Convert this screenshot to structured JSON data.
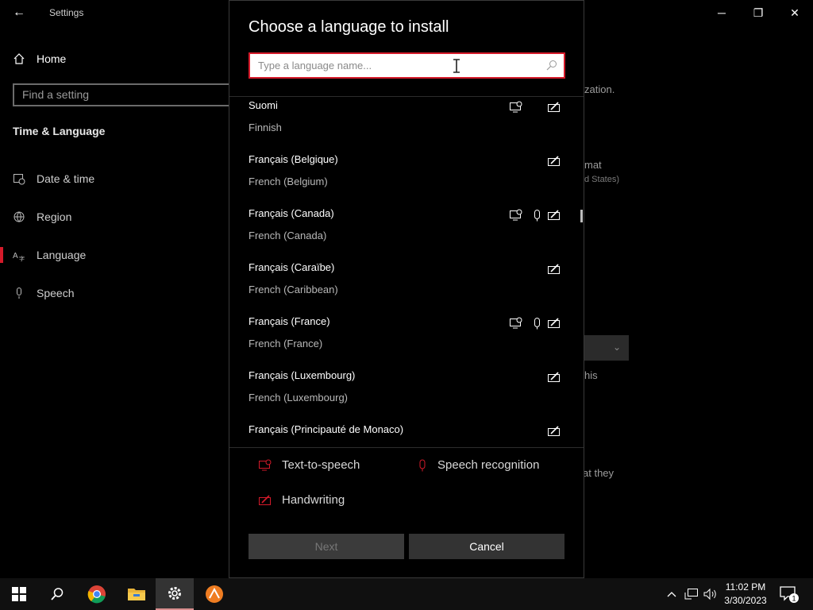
{
  "window": {
    "app_title": "Settings",
    "back_glyph": "←",
    "minimize_glyph": "─",
    "maximize_glyph": "❐",
    "close_glyph": "✕"
  },
  "sidebar": {
    "home_label": "Home",
    "search_placeholder": "Find a setting",
    "section_title": "Time & Language",
    "items": [
      {
        "label": "Date & time",
        "icon": "calendar-clock-icon"
      },
      {
        "label": "Region",
        "icon": "globe-icon"
      },
      {
        "label": "Language",
        "icon": "language-icon",
        "selected": true
      },
      {
        "label": "Speech",
        "icon": "microphone-icon"
      }
    ]
  },
  "background_fragments": {
    "frag1": "zation.",
    "frag2": "mat",
    "frag3": "d States)",
    "frag4": "his",
    "frag5": "at they"
  },
  "dialog": {
    "title": "Choose a language to install",
    "search_placeholder": "Type a language name...",
    "languages": [
      {
        "name": "Suomi",
        "english": "Finnish",
        "tts": true,
        "speech": false,
        "handwriting": true
      },
      {
        "name": "Français (Belgique)",
        "english": "French (Belgium)",
        "tts": false,
        "speech": false,
        "handwriting": true
      },
      {
        "name": "Français (Canada)",
        "english": "French (Canada)",
        "tts": true,
        "speech": true,
        "handwriting": true
      },
      {
        "name": "Français (Caraïbe)",
        "english": "French (Caribbean)",
        "tts": false,
        "speech": false,
        "handwriting": true
      },
      {
        "name": "Français (France)",
        "english": "French (France)",
        "tts": true,
        "speech": true,
        "handwriting": true
      },
      {
        "name": "Français (Luxembourg)",
        "english": "French (Luxembourg)",
        "tts": false,
        "speech": false,
        "handwriting": true
      },
      {
        "name": "Français (Principauté de Monaco)",
        "english": "",
        "tts": false,
        "speech": false,
        "handwriting": true
      }
    ],
    "legend": {
      "tts_label": "Text-to-speech",
      "speech_label": "Speech recognition",
      "handwriting_label": "Handwriting"
    },
    "next_label": "Next",
    "cancel_label": "Cancel"
  },
  "taskbar": {
    "time": "11:02 PM",
    "date": "3/30/2023",
    "notification_count": "1"
  },
  "colors": {
    "accent": "#d51a2a",
    "background": "#000000",
    "taskbar": "#101010"
  }
}
